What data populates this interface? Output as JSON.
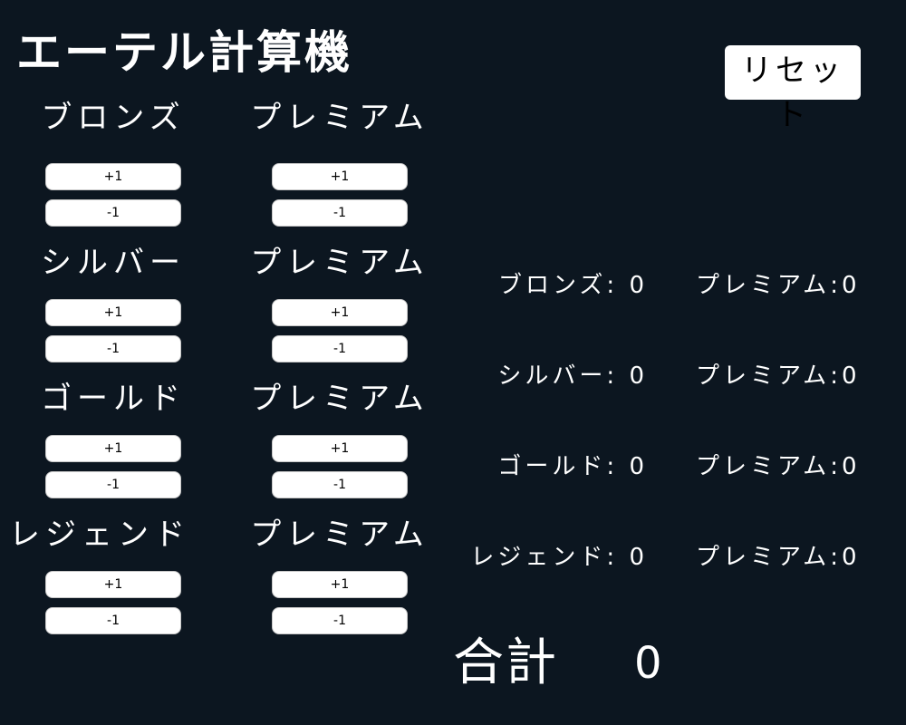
{
  "title": "エーテル計算機",
  "reset_label": "リセット",
  "plus_label": "+1",
  "minus_label": "-1",
  "groups": [
    {
      "name": "ブロンズ",
      "premium": "プレミアム",
      "count": "0",
      "premium_count": "0"
    },
    {
      "name": "シルバー",
      "premium": "プレミアム",
      "count": "0",
      "premium_count": "0"
    },
    {
      "name": "ゴールド",
      "premium": "プレミアム",
      "count": "0",
      "premium_count": "0"
    },
    {
      "name": "レジェンド",
      "premium": "プレミアム",
      "count": "0",
      "premium_count": "0"
    }
  ],
  "total_label": "合計",
  "total_value": "0"
}
